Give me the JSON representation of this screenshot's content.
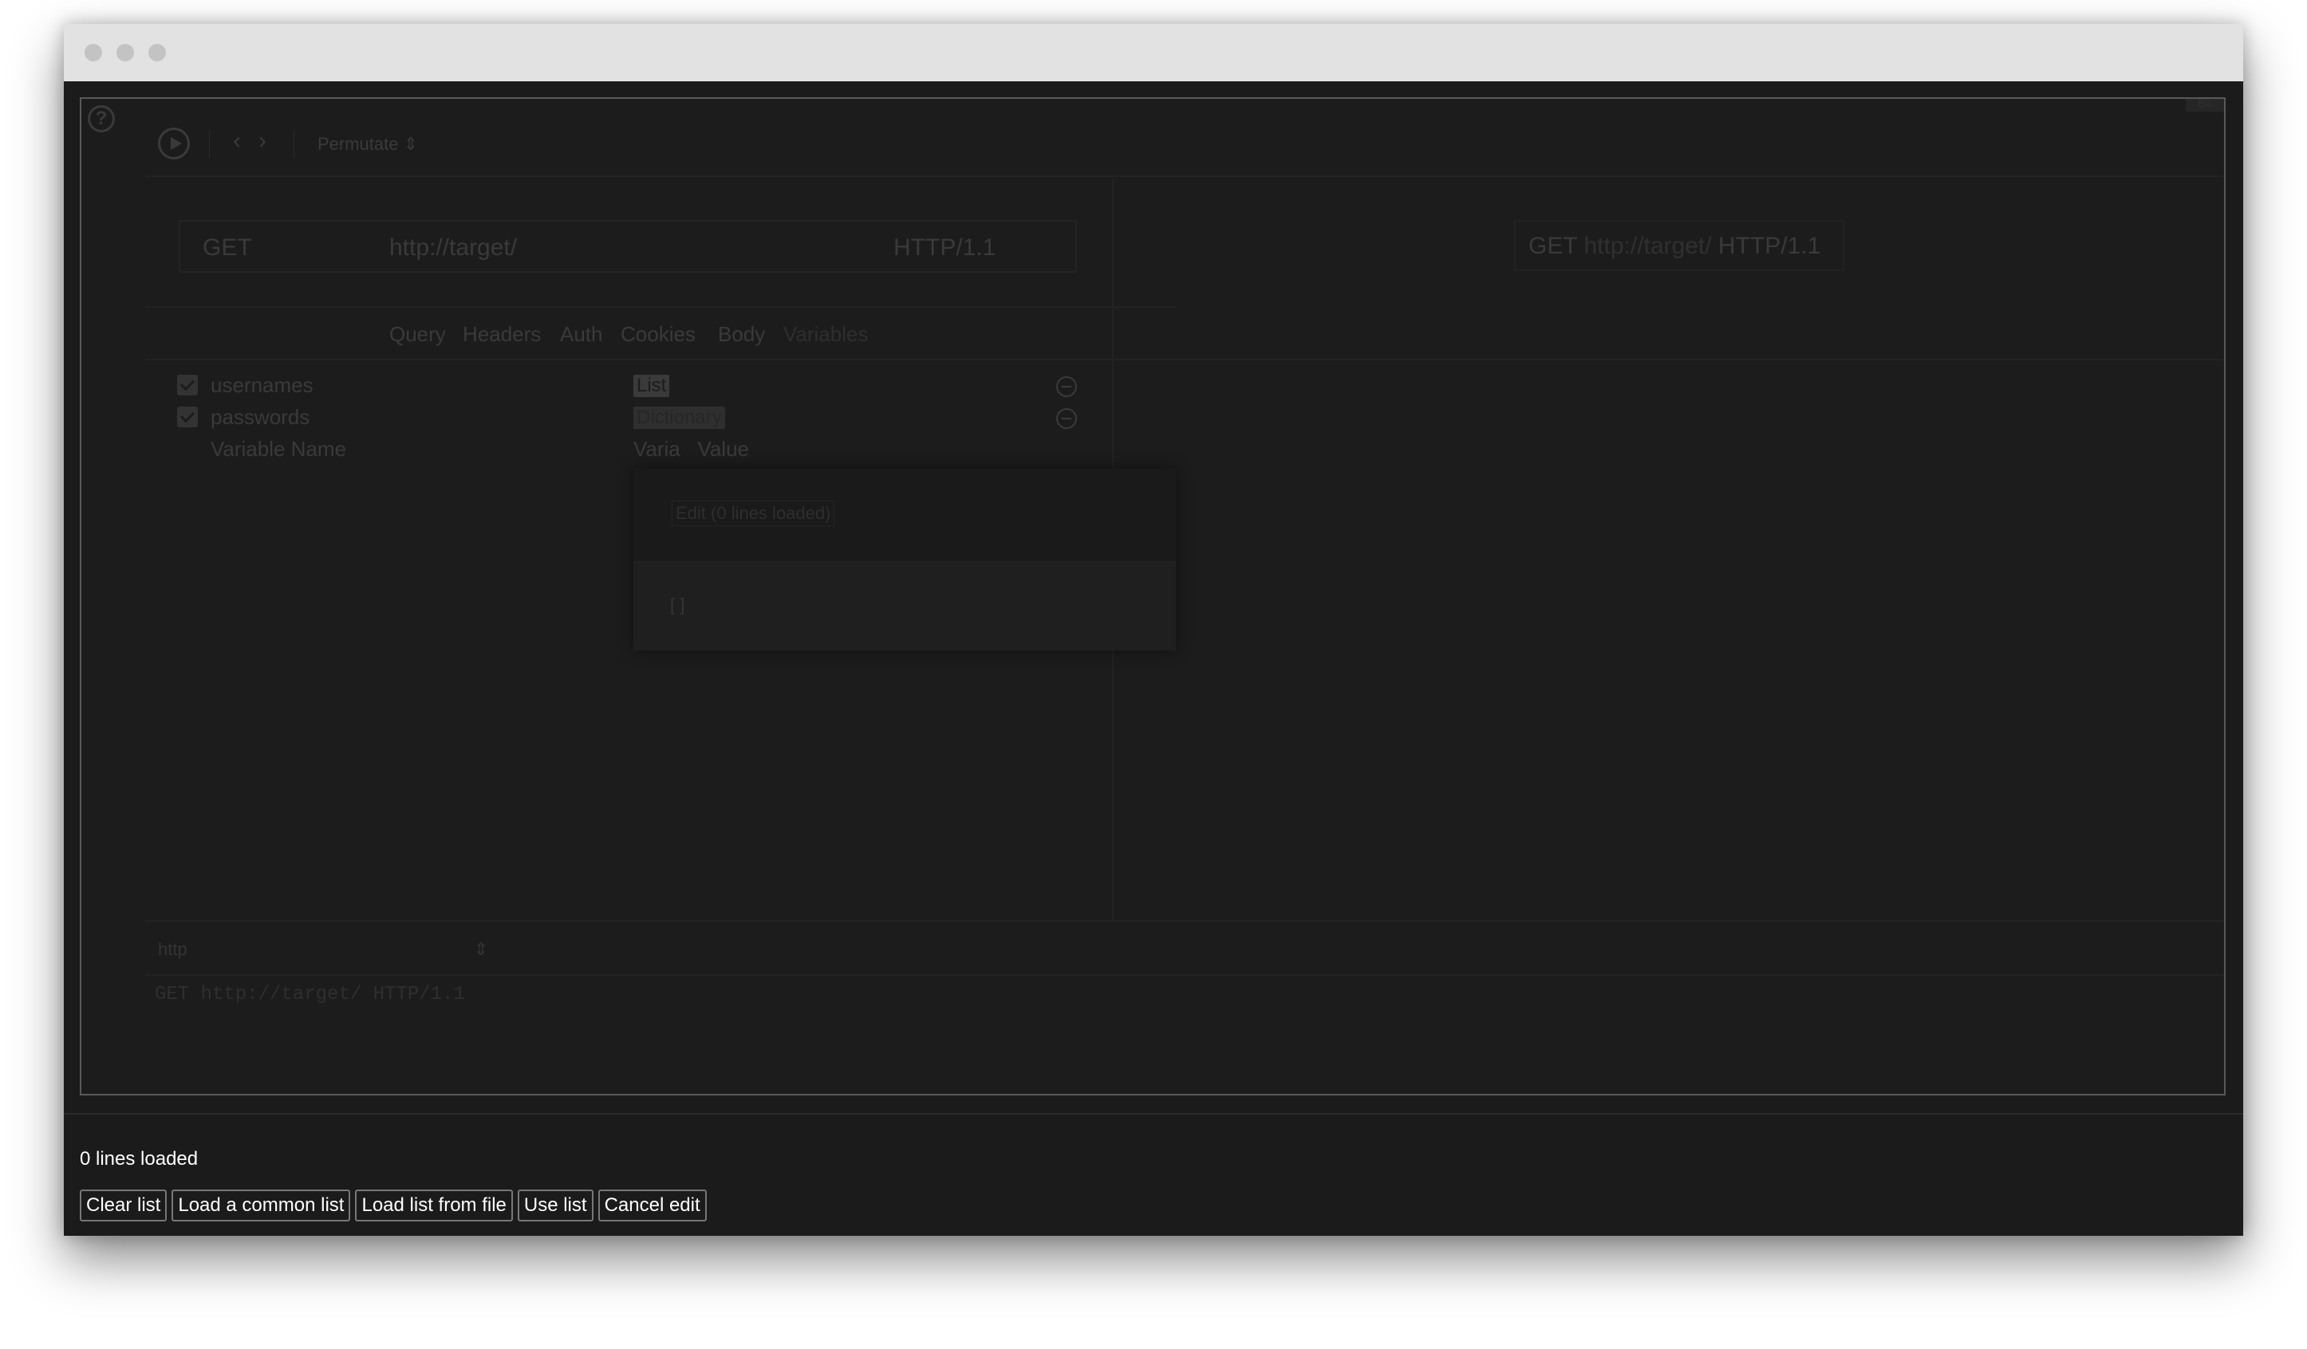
{
  "toolbar": {
    "help_glyph": "?",
    "corner_badge": "Ba",
    "back_glyph": "‹",
    "forward_glyph": "›",
    "attack_mode": "Permutate ⇕"
  },
  "request": {
    "method": "GET",
    "url": "http://target/",
    "version": "HTTP/1.1"
  },
  "tabs": [
    {
      "label": "Query"
    },
    {
      "label": "Headers"
    },
    {
      "label": "Auth"
    },
    {
      "label": "Cookies"
    },
    {
      "label": "Body"
    },
    {
      "label": "Variables"
    }
  ],
  "variables": [
    {
      "name": "usernames",
      "type": "List"
    },
    {
      "name": "passwords",
      "type": "Dictionary"
    }
  ],
  "new_variable": {
    "name_placeholder": "Variable Name",
    "value_placeholder": "Varia   Value"
  },
  "popup": {
    "edit_label": "Edit (0 lines loaded)",
    "content": "[ ]"
  },
  "preview": {
    "method": "GET",
    "url": "http://target/",
    "version": "HTTP/1.1"
  },
  "bottom": {
    "protocol": "http",
    "raw": "GET http://target/ HTTP/1.1"
  },
  "status": "0 lines loaded",
  "buttons": {
    "clear": "Clear list",
    "load_common": "Load a common list",
    "load_file": "Load list from file",
    "use": "Use list",
    "cancel": "Cancel edit"
  }
}
